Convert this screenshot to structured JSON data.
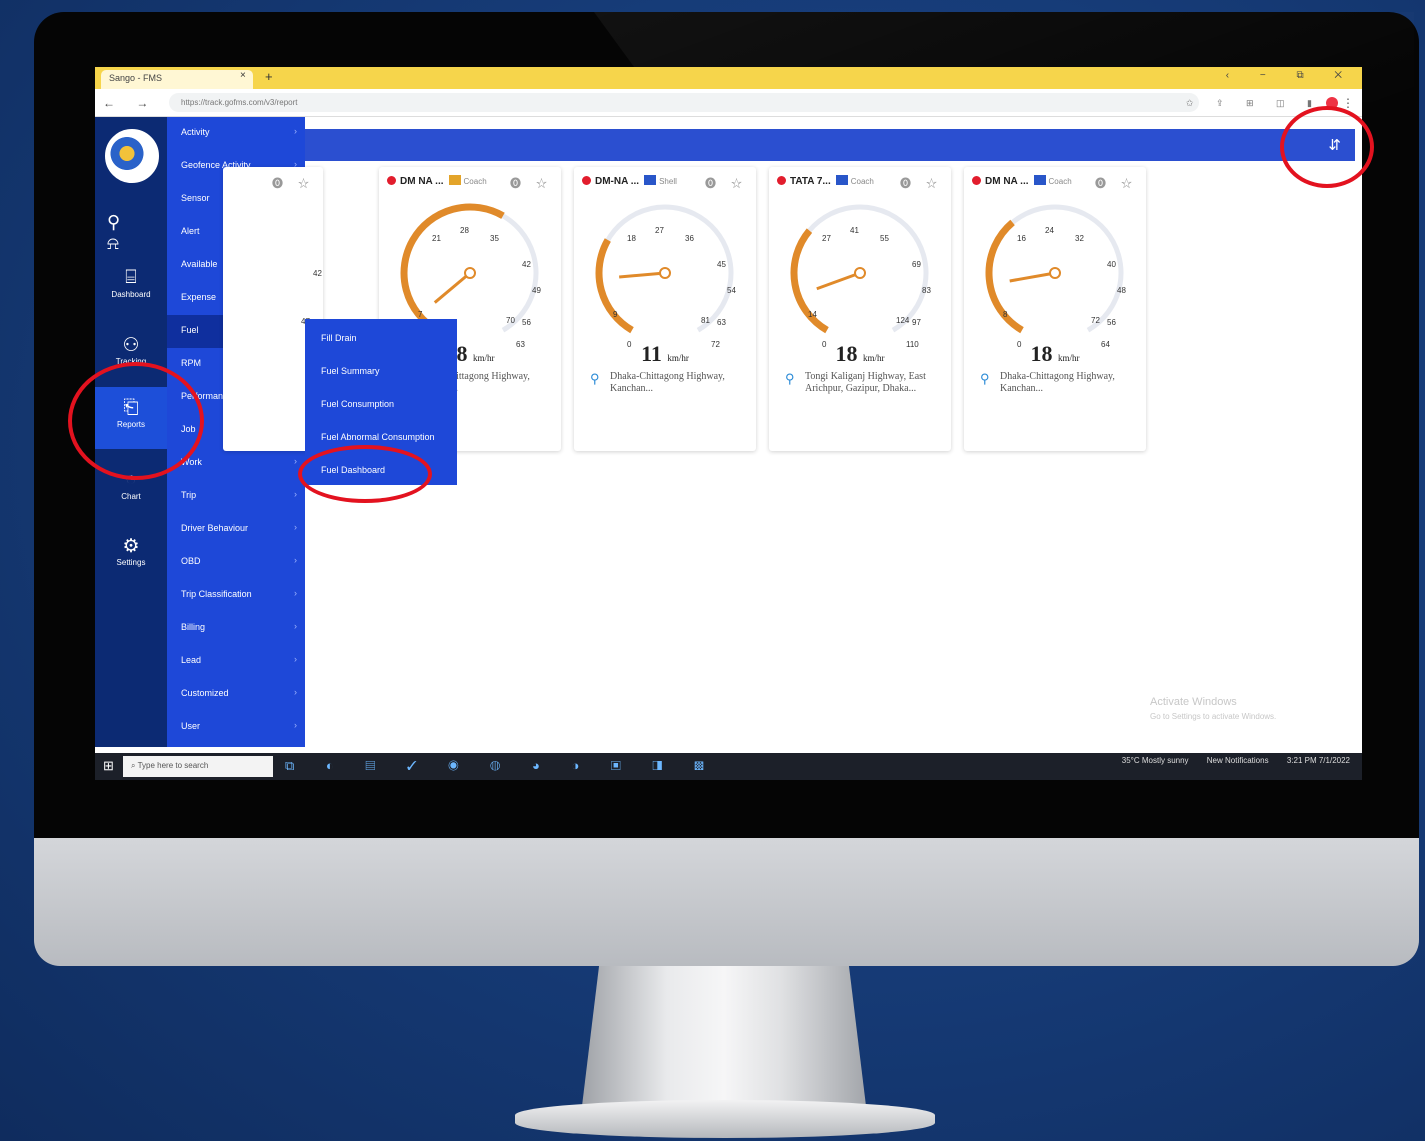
{
  "browser": {
    "tab_title": "Sango - FMS",
    "close": "×",
    "new_tab": "+",
    "window_controls": "‹ − ⧉ ✕",
    "nav_buttons": "← → ↻",
    "url": "https://track.gofms.com/v3/report",
    "extensions": "✩ ⇪ ⊞ ◫ ▮",
    "menu": "⋮"
  },
  "app": {
    "top_icons": "⚲ ⍾",
    "rail": [
      {
        "icon": "⌸",
        "label": "Dashboard"
      },
      {
        "icon": "⚇",
        "label": "Tracking"
      },
      {
        "icon": "⎗",
        "label": "Reports"
      },
      {
        "icon": "◔",
        "label": "Chart"
      },
      {
        "icon": "⚙",
        "label": "Settings"
      }
    ],
    "menu_items": [
      "Activity",
      "Geofence Activity",
      "Sensor",
      "Alert",
      "Available",
      "Expense",
      "Fuel",
      "RPM",
      "Performance",
      "Job",
      "Work",
      "Trip",
      "Driver Behaviour",
      "OBD",
      "Trip Classification",
      "Billing",
      "Lead",
      "Customized",
      "User"
    ],
    "menu_arrow": "›",
    "submenu_items": [
      "Fill Drain",
      "Fuel Summary",
      "Fuel Consumption",
      "Fuel Abnormal Consumption",
      "Fuel Dashboard"
    ],
    "topbar_icon": "⇵"
  },
  "cards": [
    {
      "name": "DM NA ...",
      "badge": "Coach",
      "speed": "28",
      "unit": "km/hr",
      "location": "Dhaka-Chittagong Highway, Kanchan...",
      "ticks": [
        "21",
        "28",
        "35",
        "42",
        "49",
        "56",
        "7",
        "14",
        "63",
        "70"
      ]
    },
    {
      "name": "DM-NA ...",
      "badge": "Shell",
      "speed": "11",
      "unit": "km/hr",
      "location": "Dhaka-Chittagong Highway, Kanchan...",
      "ticks": [
        "18",
        "27",
        "36",
        "45",
        "54",
        "63",
        "9",
        "0",
        "72",
        "81"
      ]
    },
    {
      "name": "TATA 7...",
      "badge": "Coach",
      "speed": "18",
      "unit": "km/hr",
      "location": "Tongi Kaliganj Highway, East Arichpur, Gazipur, Dhaka...",
      "ticks": [
        "27",
        "41",
        "55",
        "69",
        "83",
        "97",
        "14",
        "0",
        "110",
        "124"
      ]
    },
    {
      "name": "DM NA ...",
      "badge": "Coach",
      "speed": "18",
      "unit": "km/hr",
      "location": "Dhaka-Chittagong Highway, Kanchan...",
      "ticks": [
        "16",
        "24",
        "32",
        "40",
        "48",
        "56",
        "8",
        "0",
        "64",
        "72"
      ]
    }
  ],
  "card_controls": "⓿ ☆",
  "partial_card": {
    "ticks": [
      "42",
      "47"
    ],
    "controls": "⓿ ☆"
  },
  "watermark": {
    "title": "Activate Windows",
    "subtitle": "Go to Settings to activate Windows."
  },
  "taskbar": {
    "start": "⊞",
    "search": "Type here to search",
    "apps": "⧉ ◐ ▤ ✓ ◉ ◍ ◕ ◑ ▣ ◨ ▩",
    "weather": "35°C Mostly sunny",
    "news": "New Notifications",
    "clock": "3:21 PM",
    "date": "7/1/2022"
  },
  "colors": {
    "accent": "#1e48d8",
    "rail": "#0c2a73",
    "gauge_fill": "#e08a2a",
    "status_red": "#e21d2d",
    "highlight": "#e3121f"
  }
}
